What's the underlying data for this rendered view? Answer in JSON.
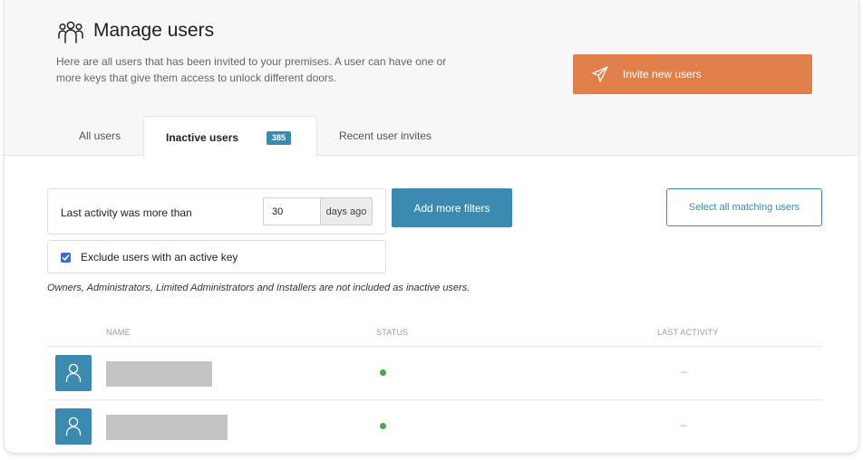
{
  "header": {
    "title": "Manage users",
    "title_icon": "users-group-icon",
    "intro": "Here are all users that has been invited to your premises. A user can have one or more keys that give them access to unlock different doors.",
    "invite_button": {
      "label": "Invite new users",
      "icon": "paper-plane-icon",
      "color": "#e07f4a"
    }
  },
  "tabs": [
    {
      "label": "All users",
      "active": false
    },
    {
      "label": "Inactive users",
      "active": true,
      "badge": "385"
    },
    {
      "label": "Recent user invites",
      "active": false
    }
  ],
  "filters": {
    "activity_label": "Last activity was more than",
    "days_value": "30",
    "days_suffix": "days ago",
    "add_filters_label": "Add more filters",
    "select_all_label": "Select all matching users",
    "exclude_label": "Exclude users with an active key",
    "exclude_checked": true,
    "note": "Owners, Administrators, Limited Administrators and Installers are not included as inactive users."
  },
  "table": {
    "columns": [
      "NAME",
      "STATUS",
      "LAST ACTIVITY"
    ],
    "rows": [
      {
        "status_color": "#46a84a",
        "last_activity": "–"
      },
      {
        "status_color": "#46a84a",
        "last_activity": "–"
      }
    ]
  },
  "colors": {
    "accent": "#3c8ab0",
    "primary_action": "#e07f4a",
    "status_active": "#46a84a"
  }
}
